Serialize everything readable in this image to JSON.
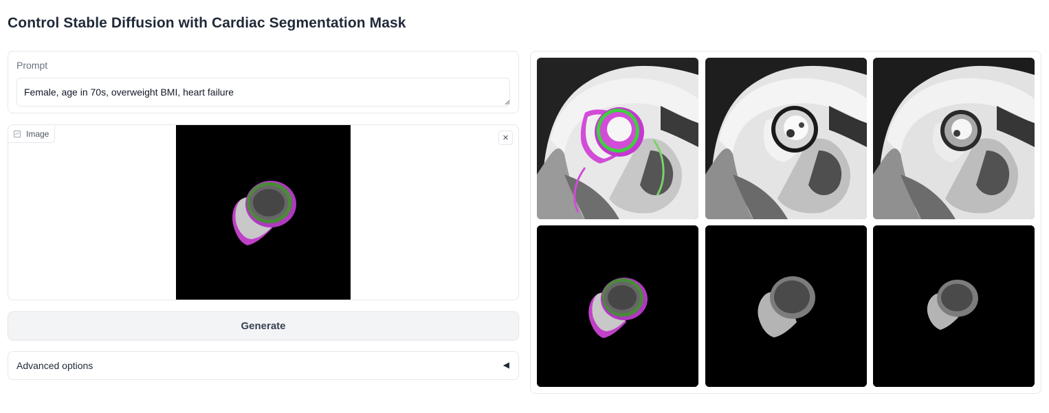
{
  "page": {
    "title": "Control Stable Diffusion with Cardiac Segmentation Mask"
  },
  "prompt": {
    "label": "Prompt",
    "value": "Female, age in 70s, overweight BMI, heart failure"
  },
  "image_input": {
    "label": "Image",
    "clear_glyph": "×"
  },
  "generate": {
    "label": "Generate"
  },
  "advanced": {
    "label": "Advanced options",
    "arrow": "◀"
  },
  "colors": {
    "mask_magenta": "#c040c8",
    "mask_green": "#4a8a3a",
    "button_bg": "#f3f4f6",
    "border": "#e5e7eb"
  },
  "gallery": {
    "items": [
      {
        "kind": "mri-overlay"
      },
      {
        "kind": "mri"
      },
      {
        "kind": "mri"
      },
      {
        "kind": "mask-color"
      },
      {
        "kind": "mask-gray"
      },
      {
        "kind": "mask-gray-small"
      }
    ]
  }
}
